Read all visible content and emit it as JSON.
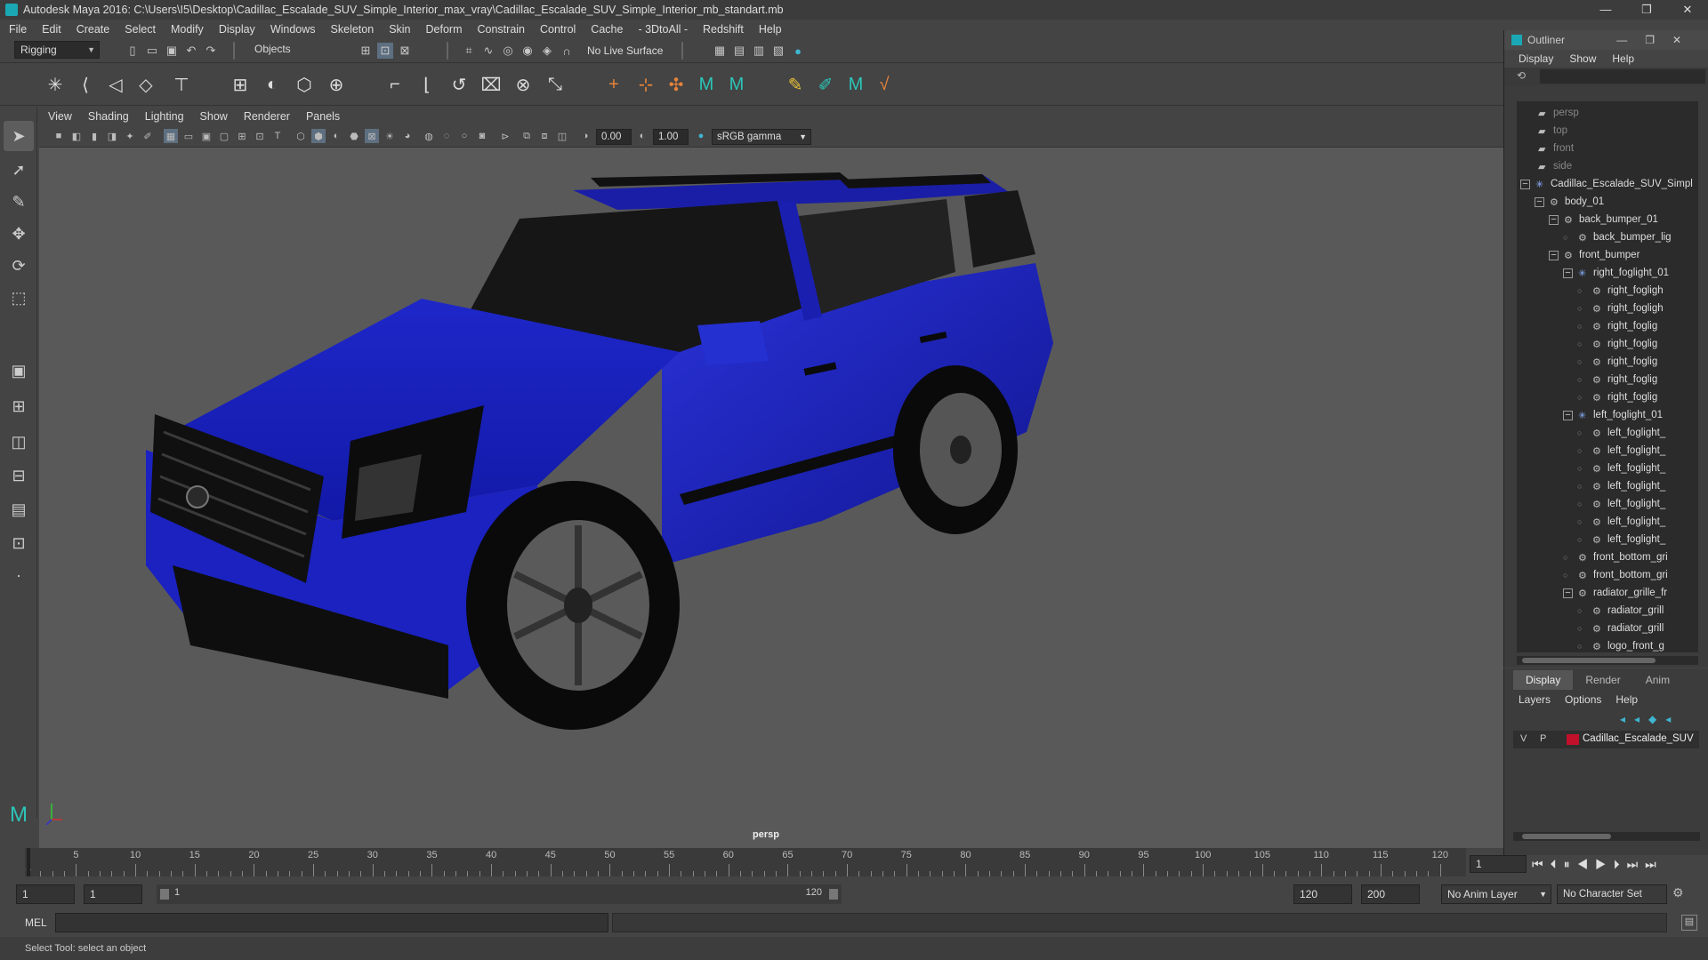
{
  "window": {
    "title": "Autodesk Maya 2016: C:\\Users\\I5\\Desktop\\Cadillac_Escalade_SUV_Simple_Interior_max_vray\\Cadillac_Escalade_SUV_Simple_Interior_mb_standart.mb",
    "minimize": "—",
    "restore": "❐",
    "close": "✕"
  },
  "menubar": [
    "File",
    "Edit",
    "Create",
    "Select",
    "Modify",
    "Display",
    "Windows",
    "Skeleton",
    "Skin",
    "Deform",
    "Constrain",
    "Control",
    "Cache",
    "- 3DtoAll -",
    "Redshift",
    "Help"
  ],
  "status_line": {
    "menuset": "Rigging",
    "select_mode": "Objects",
    "live_surface": "No Live Surface"
  },
  "viewport": {
    "menu": [
      "View",
      "Shading",
      "Lighting",
      "Show",
      "Renderer",
      "Panels"
    ],
    "exposure": "0.00",
    "gamma": "1.00",
    "color_space": "sRGB gamma",
    "camera_label": "persp",
    "car_color": "#1a1eb8"
  },
  "outliner": {
    "title": "Outliner",
    "menu": [
      "Display",
      "Show",
      "Help"
    ],
    "items": [
      {
        "label": "persp",
        "depth": 0,
        "cam": true
      },
      {
        "label": "top",
        "depth": 0,
        "cam": true
      },
      {
        "label": "front",
        "depth": 0,
        "cam": true
      },
      {
        "label": "side",
        "depth": 0,
        "cam": true
      },
      {
        "label": "Cadillac_Escalade_SUV_Simpl",
        "depth": 0,
        "exp": true
      },
      {
        "label": "body_01",
        "depth": 1,
        "exp": true
      },
      {
        "label": "back_bumper_01",
        "depth": 2,
        "exp": true
      },
      {
        "label": "back_bumper_lig",
        "depth": 3
      },
      {
        "label": "front_bumper",
        "depth": 2,
        "exp": true
      },
      {
        "label": "right_foglight_01",
        "depth": 3,
        "exp": true
      },
      {
        "label": "right_fogligh",
        "depth": 4
      },
      {
        "label": "right_fogligh",
        "depth": 4
      },
      {
        "label": "right_foglig",
        "depth": 4
      },
      {
        "label": "right_foglig",
        "depth": 4
      },
      {
        "label": "right_foglig",
        "depth": 4
      },
      {
        "label": "right_foglig",
        "depth": 4
      },
      {
        "label": "right_foglig",
        "depth": 4
      },
      {
        "label": "left_foglight_01",
        "depth": 3,
        "exp": true
      },
      {
        "label": "left_foglight_",
        "depth": 4
      },
      {
        "label": "left_foglight_",
        "depth": 4
      },
      {
        "label": "left_foglight_",
        "depth": 4
      },
      {
        "label": "left_foglight_",
        "depth": 4
      },
      {
        "label": "left_foglight_",
        "depth": 4
      },
      {
        "label": "left_foglight_",
        "depth": 4
      },
      {
        "label": "left_foglight_",
        "depth": 4
      },
      {
        "label": "front_bottom_gri",
        "depth": 3
      },
      {
        "label": "front_bottom_gri",
        "depth": 3
      },
      {
        "label": "radiator_grille_fr",
        "depth": 3,
        "exp": true
      },
      {
        "label": "radiator_grill",
        "depth": 4
      },
      {
        "label": "radiator_grill",
        "depth": 4
      },
      {
        "label": "logo_front_g",
        "depth": 4
      }
    ]
  },
  "layers": {
    "tabs": [
      "Display",
      "Render",
      "Anim"
    ],
    "menu": [
      "Layers",
      "Options",
      "Help"
    ],
    "row": {
      "v": "V",
      "p": "P",
      "name": "Cadillac_Escalade_SUV",
      "color": "#c0102a"
    }
  },
  "timeline": {
    "labels": [
      "1",
      "5",
      "10",
      "15",
      "20",
      "25",
      "30",
      "35",
      "40",
      "45",
      "50",
      "55",
      "60",
      "65",
      "70",
      "75",
      "80",
      "85",
      "90",
      "95",
      "100",
      "105",
      "110",
      "115",
      "120"
    ],
    "current_frame": "1"
  },
  "range": {
    "start": "1",
    "playback_start": "1",
    "slider_start": "1",
    "slider_end": "120",
    "playback_end": "120",
    "end": "200",
    "anim_layer": "No Anim Layer",
    "character_set": "No Character Set"
  },
  "cmdline": {
    "label": "MEL"
  },
  "helpline": {
    "text": "Select Tool: select an object"
  }
}
